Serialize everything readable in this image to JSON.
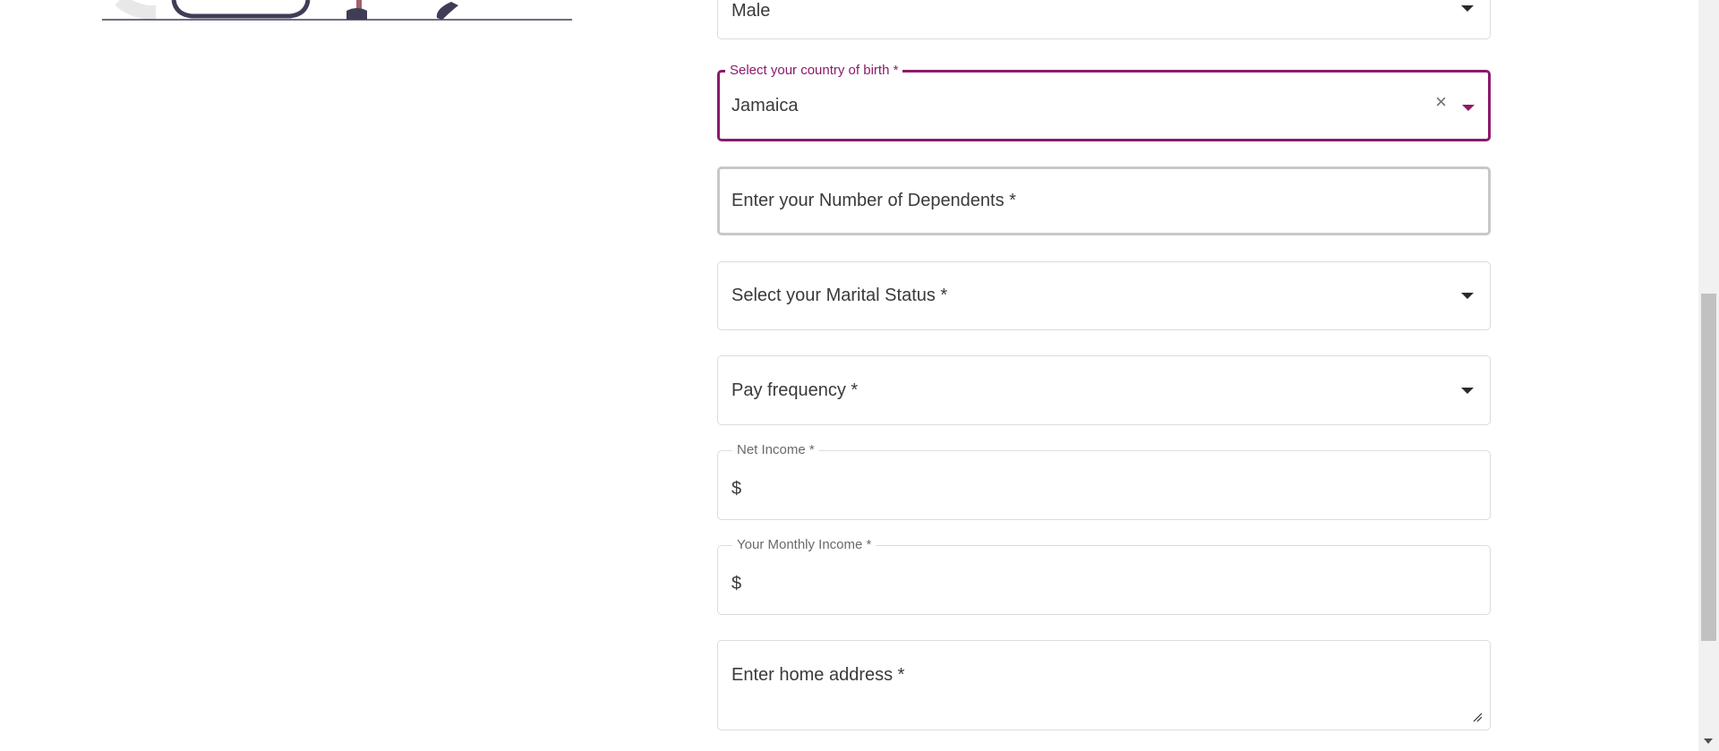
{
  "form": {
    "gender": {
      "value": "Male"
    },
    "country_of_birth": {
      "label": "Select your country of birth *",
      "value": "Jamaica"
    },
    "dependents": {
      "placeholder": "Enter your Number of Dependents *"
    },
    "marital_status": {
      "placeholder": "Select your Marital Status *"
    },
    "pay_frequency": {
      "placeholder": "Pay frequency *"
    },
    "net_income": {
      "label": "Net Income *",
      "prefix": "$"
    },
    "monthly_income": {
      "label": "Your Monthly Income *",
      "prefix": "$"
    },
    "home_address": {
      "placeholder": "Enter home address *"
    }
  },
  "icons": {
    "clear": "×"
  },
  "colors": {
    "accent": "#8b1a6b",
    "border": "#dcdcdc",
    "illustration_dark": "#3f3d56",
    "illustration_skin": "#a0616a"
  }
}
